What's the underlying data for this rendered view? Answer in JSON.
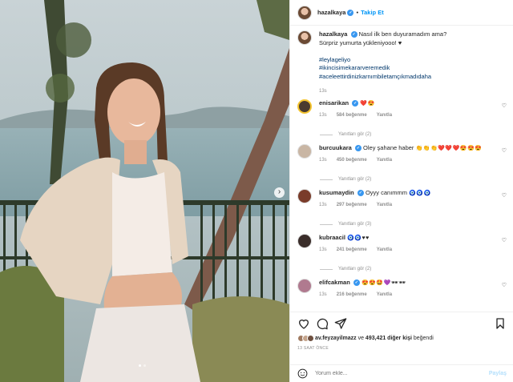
{
  "post": {
    "username": "hazalkaya",
    "follow_label": "Takip Et",
    "caption_line1": "Nasıl ilk ben duyuramadım ama?",
    "caption_line2": "Sürpriz yumurta yükleniyooo! ♥",
    "hashtags": [
      "#leylageliyo",
      "#ikincisimekararveremedik",
      "#aceleettirdinizkarnımbiletamçıkmadıdaha"
    ],
    "caption_time": "13s"
  },
  "comments": [
    {
      "user": "enisarikan",
      "text": "",
      "emoji": "❤️😍",
      "time": "13s",
      "likes": "584 beğenme",
      "reply": "Yanıtla",
      "replies": "Yanıtları gör (2)",
      "avatar_color": "#4a3b2f"
    },
    {
      "user": "burcuukara",
      "text": "Oley şahane haber",
      "emoji": "👏👏👏❤️❤️❤️😍😍😍",
      "time": "13s",
      "likes": "450 beğenme",
      "reply": "Yanıtla",
      "replies": "Yanıtları gör (2)",
      "avatar_color": "#c9b6a4"
    },
    {
      "user": "kusumaydin",
      "text": "Oyyy canımmm",
      "emoji": "🧿🧿🧿",
      "time": "13s",
      "likes": "297 beğenme",
      "reply": "Yanıtla",
      "replies": "Yanıtları gör (3)",
      "avatar_color": "#7a3c2a"
    },
    {
      "user": "kubraacil",
      "text": "",
      "emoji": "🧿🧿♥♥",
      "time": "13s",
      "likes": "241 beğenme",
      "reply": "Yanıtla",
      "replies": "Yanıtları gör (2)",
      "avatar_color": "#3a2d2a"
    },
    {
      "user": "elifcakman",
      "text": "",
      "emoji": "😍😍🤩💜🕶🕶",
      "time": "13s",
      "likes": "216 beğenme",
      "reply": "Yanıtla",
      "replies": "",
      "avatar_color": "#b07a8f"
    }
  ],
  "likes": {
    "first_user": "av.feyzayilmazz",
    "middle": " ve ",
    "count_text": "493,421 diğer kişi",
    "suffix": " beğendi"
  },
  "timestamp": "13 SAAT ÖNCE",
  "add_comment": {
    "placeholder": "Yorum ekle...",
    "post_label": "Paylaş"
  },
  "colors": {
    "link": "#0095f6",
    "hashtag": "#00376b",
    "muted": "#8e8e8e"
  }
}
